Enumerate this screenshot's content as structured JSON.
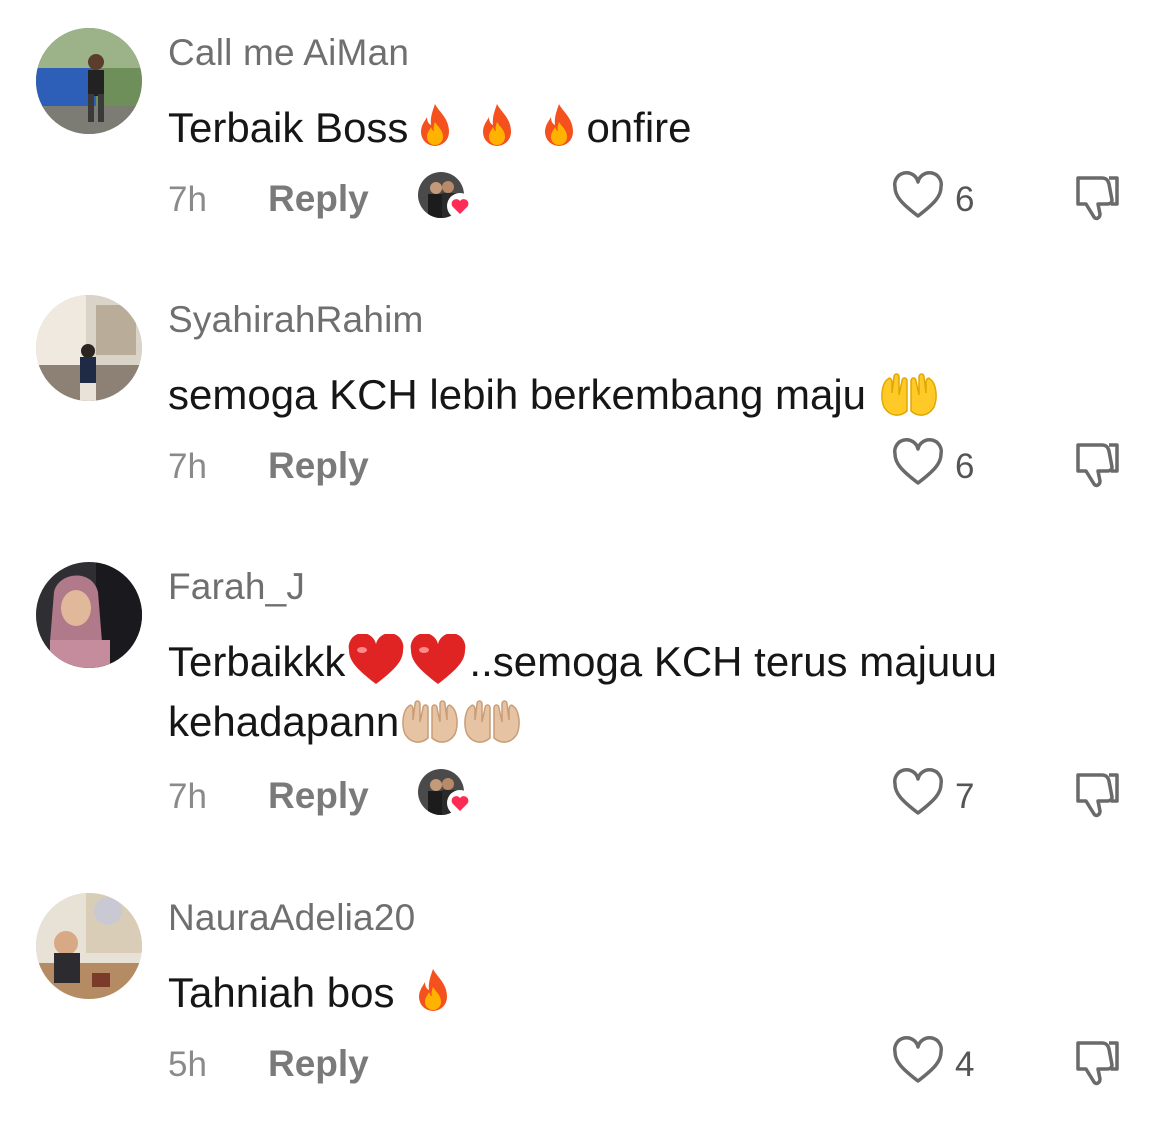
{
  "comments": [
    {
      "username": "Call me AiMan",
      "text_before": "Terbaik Boss",
      "emojis": [
        "fire-emoji",
        "fire-emoji",
        "fire-emoji"
      ],
      "text_after": "onfire",
      "time": "7h",
      "reply_label": "Reply",
      "liked_by_creator": true,
      "like_count": "6"
    },
    {
      "username": "SyahirahRahim",
      "text_before": "semoga KCH lebih berkembang maju",
      "emojis": [
        "palms-up-emoji"
      ],
      "text_after": "",
      "time": "7h",
      "reply_label": "Reply",
      "liked_by_creator": false,
      "like_count": "6"
    },
    {
      "username": "Farah_J",
      "text_before": "Terbaikkk",
      "emojis": [
        "heart-emoji",
        "heart-emoji"
      ],
      "text_after": "..semoga KCH terus majuuu kehadapann",
      "trailing_emojis": [
        "palms-up-emoji",
        "palms-up-emoji"
      ],
      "time": "7h",
      "reply_label": "Reply",
      "liked_by_creator": true,
      "like_count": "7"
    },
    {
      "username": "NauraAdelia20",
      "text_before": "Tahniah bos",
      "emojis": [
        "fire-emoji"
      ],
      "text_after": "",
      "time": "5h",
      "reply_label": "Reply",
      "liked_by_creator": false,
      "like_count": "4"
    }
  ],
  "colors": {
    "username": "#6f6f6f",
    "meta": "#8a8a8a",
    "heart_badge": "#fe2c55"
  },
  "icons": {
    "like": "heart-outline-icon",
    "dislike": "thumbs-down-icon"
  }
}
